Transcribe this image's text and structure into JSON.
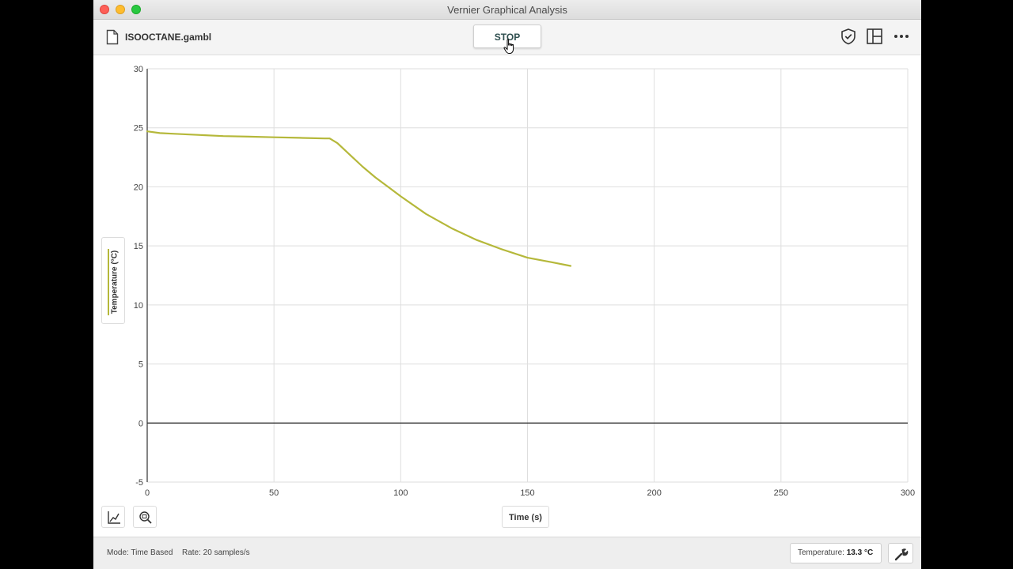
{
  "window": {
    "title": "Vernier Graphical Analysis"
  },
  "toolbar": {
    "file_name": "ISOOCTANE.gambl",
    "stop_label": "STOP"
  },
  "icons": {
    "file": "file-icon",
    "shield": "shield-check-icon",
    "layout": "layout-panels-icon",
    "more": "more-horizontal-icon",
    "cursor": "hand-pointer-cursor-icon",
    "graph_options": "graph-options-icon",
    "zoom": "zoom-icon",
    "settings": "wrench-icon"
  },
  "graph": {
    "y_axis_label": "Temperature (°C)",
    "x_axis_label": "Time (s)"
  },
  "status": {
    "mode": "Mode: Time Based",
    "rate": "Rate: 20 samples/s",
    "meter_label": "Temperature:",
    "meter_value": "13.3 °C"
  },
  "colors": {
    "series": "#b5b83a",
    "grid": "#dedede",
    "axis": "#333333"
  },
  "chart_data": {
    "type": "line",
    "xlabel": "Time (s)",
    "ylabel": "Temperature (°C)",
    "xlim": [
      0,
      300
    ],
    "ylim": [
      -5,
      30
    ],
    "x_ticks": [
      0,
      50,
      100,
      150,
      200,
      250,
      300
    ],
    "y_ticks": [
      -5,
      0,
      5,
      10,
      15,
      20,
      25,
      30
    ],
    "grid": true,
    "series": [
      {
        "name": "Temperature",
        "x": [
          0,
          5,
          10,
          20,
          30,
          40,
          50,
          60,
          70,
          72,
          75,
          80,
          85,
          90,
          95,
          100,
          110,
          120,
          130,
          140,
          150,
          160,
          167
        ],
        "y": [
          24.7,
          24.55,
          24.5,
          24.4,
          24.3,
          24.25,
          24.2,
          24.15,
          24.1,
          24.1,
          23.7,
          22.7,
          21.7,
          20.8,
          20.0,
          19.2,
          17.7,
          16.5,
          15.5,
          14.7,
          14.0,
          13.6,
          13.3
        ]
      }
    ]
  }
}
